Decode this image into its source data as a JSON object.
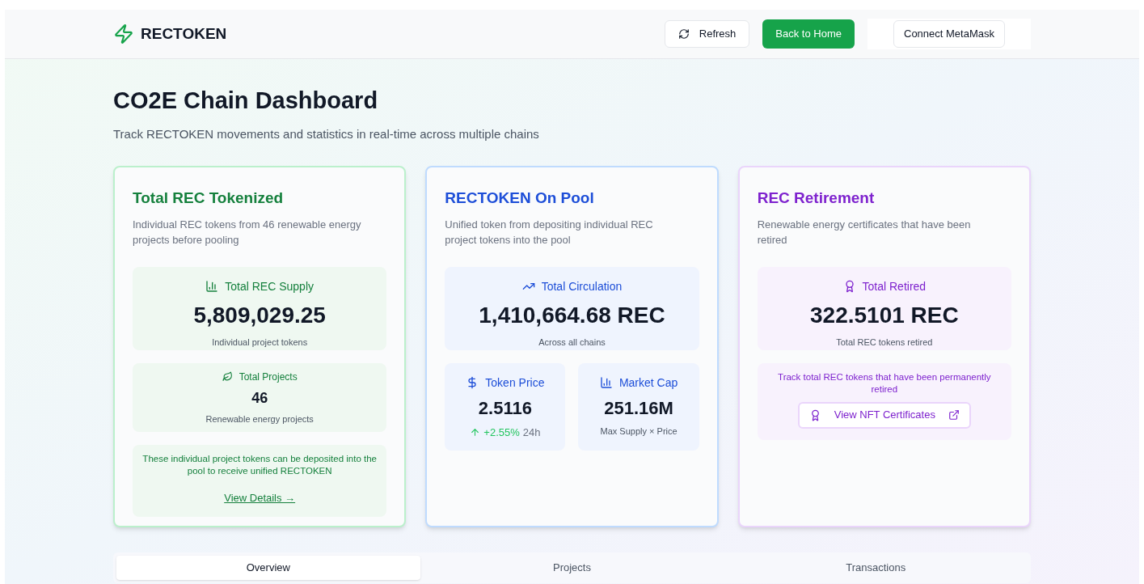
{
  "header": {
    "brand": "RECTOKEN",
    "buttons": [
      {
        "kind": "refresh",
        "label": "Refresh"
      },
      {
        "kind": "primary",
        "label": "Back to Home"
      },
      {
        "kind": "plain",
        "label": "Connect MetaMask"
      }
    ]
  },
  "page": {
    "title": "CO2E Chain Dashboard",
    "subtitle": "Track RECTOKEN movements and statistics in real-time across multiple chains"
  },
  "cards": [
    {
      "color": "#15803d",
      "title": "Total REC Tokenized",
      "description": "Individual REC tokens from 46 renewable energy projects before pooling",
      "blocks": [
        {
          "kind": "hero",
          "label": "Total REC Supply",
          "value": "5,809,029.25",
          "caption": "Individual project tokens"
        },
        {
          "kind": "stat",
          "label": "Total Projects",
          "value": "46",
          "caption": "Renewable energy projects"
        },
        {
          "kind": "note",
          "text": "These individual project tokens can be deposited into the pool to receive unified RECTOKEN",
          "link": "View Details →"
        }
      ]
    },
    {
      "color": "#1d4ed8",
      "title": "RECTOKEN On Pool",
      "description": "Unified token from depositing individual REC project tokens into the pool",
      "blocks": [
        {
          "kind": "hero",
          "label": "Total Circulation",
          "value": "1,410,664.68 REC",
          "caption": "Across all chains"
        },
        {
          "kind": "pair",
          "items": [
            {
              "label": "Token Price",
              "value": "2.5116",
              "change": "+2.55%",
              "period": "24h"
            },
            {
              "label": "Market Cap",
              "value": "251.16M",
              "caption": "Max Supply × Price"
            }
          ]
        }
      ]
    },
    {
      "color": "#7e22ce",
      "title": "REC Retirement",
      "description": "Renewable energy certificates that have been retired",
      "blocks": [
        {
          "kind": "hero",
          "label": "Total Retired",
          "value": "322.5101 REC",
          "caption": "Total REC tokens retired"
        },
        {
          "kind": "note",
          "text": "Track total REC tokens that have been permanently retired",
          "button": "View NFT Certificates"
        }
      ]
    }
  ],
  "tabs": [
    {
      "label": "Overview",
      "selected": true
    },
    {
      "label": "Projects",
      "selected": false
    },
    {
      "label": "Transactions",
      "selected": false
    }
  ]
}
